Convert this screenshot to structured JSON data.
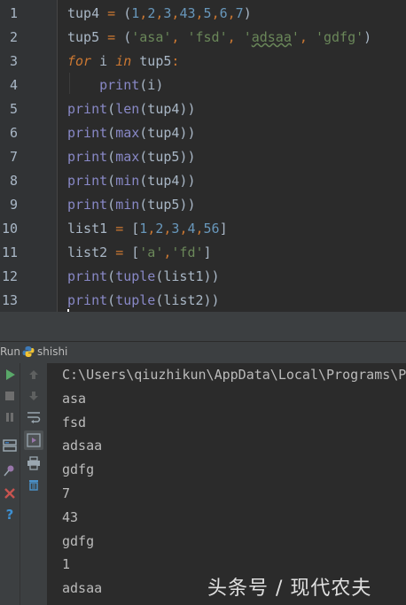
{
  "editor": {
    "line_numbers": [
      "1",
      "2",
      "3",
      "4",
      "5",
      "6",
      "7",
      "8",
      "9",
      "10",
      "11",
      "12",
      "13"
    ],
    "lines": [
      [
        {
          "t": "tup4 ",
          "c": ""
        },
        {
          "t": "=",
          "c": "op"
        },
        {
          "t": " (",
          "c": ""
        },
        {
          "t": "1",
          "c": "num"
        },
        {
          "t": ",",
          "c": "op"
        },
        {
          "t": "2",
          "c": "num"
        },
        {
          "t": ",",
          "c": "op"
        },
        {
          "t": "3",
          "c": "num"
        },
        {
          "t": ",",
          "c": "op"
        },
        {
          "t": "43",
          "c": "num"
        },
        {
          "t": ",",
          "c": "op"
        },
        {
          "t": "5",
          "c": "num"
        },
        {
          "t": ",",
          "c": "op"
        },
        {
          "t": "6",
          "c": "num"
        },
        {
          "t": ",",
          "c": "op"
        },
        {
          "t": "7",
          "c": "num"
        },
        {
          "t": ")",
          "c": ""
        }
      ],
      [
        {
          "t": "tup5 ",
          "c": ""
        },
        {
          "t": "=",
          "c": "op"
        },
        {
          "t": " (",
          "c": ""
        },
        {
          "t": "'asa'",
          "c": "str"
        },
        {
          "t": ", ",
          "c": "op"
        },
        {
          "t": "'fsd'",
          "c": "str"
        },
        {
          "t": ", ",
          "c": "op"
        },
        {
          "t": "'",
          "c": "str"
        },
        {
          "t": "adsaa",
          "c": "str squig"
        },
        {
          "t": "'",
          "c": "str"
        },
        {
          "t": ", ",
          "c": "op"
        },
        {
          "t": "'gdfg'",
          "c": "str"
        },
        {
          "t": ")",
          "c": ""
        }
      ],
      [
        {
          "t": "for",
          "c": "kw"
        },
        {
          "t": " i ",
          "c": ""
        },
        {
          "t": "in",
          "c": "kw"
        },
        {
          "t": " tup5",
          "c": ""
        },
        {
          "t": ":",
          "c": "op"
        }
      ],
      [
        {
          "t": "    ",
          "c": ""
        },
        {
          "t": "print",
          "c": "bi"
        },
        {
          "t": "(i)",
          "c": ""
        }
      ],
      [
        {
          "t": "print",
          "c": "bi"
        },
        {
          "t": "(",
          "c": ""
        },
        {
          "t": "len",
          "c": "bi"
        },
        {
          "t": "(tup4))",
          "c": ""
        }
      ],
      [
        {
          "t": "print",
          "c": "bi"
        },
        {
          "t": "(",
          "c": ""
        },
        {
          "t": "max",
          "c": "bi"
        },
        {
          "t": "(tup4))",
          "c": ""
        }
      ],
      [
        {
          "t": "print",
          "c": "bi"
        },
        {
          "t": "(",
          "c": ""
        },
        {
          "t": "max",
          "c": "bi"
        },
        {
          "t": "(tup5))",
          "c": ""
        }
      ],
      [
        {
          "t": "print",
          "c": "bi"
        },
        {
          "t": "(",
          "c": ""
        },
        {
          "t": "min",
          "c": "bi"
        },
        {
          "t": "(tup4))",
          "c": ""
        }
      ],
      [
        {
          "t": "print",
          "c": "bi"
        },
        {
          "t": "(",
          "c": ""
        },
        {
          "t": "min",
          "c": "bi"
        },
        {
          "t": "(tup5))",
          "c": ""
        }
      ],
      [
        {
          "t": "list1 ",
          "c": ""
        },
        {
          "t": "=",
          "c": "op"
        },
        {
          "t": " [",
          "c": ""
        },
        {
          "t": "1",
          "c": "num"
        },
        {
          "t": ",",
          "c": "op"
        },
        {
          "t": "2",
          "c": "num"
        },
        {
          "t": ",",
          "c": "op"
        },
        {
          "t": "3",
          "c": "num"
        },
        {
          "t": ",",
          "c": "op"
        },
        {
          "t": "4",
          "c": "num"
        },
        {
          "t": ",",
          "c": "op"
        },
        {
          "t": "56",
          "c": "num"
        },
        {
          "t": "]",
          "c": ""
        }
      ],
      [
        {
          "t": "list2 ",
          "c": ""
        },
        {
          "t": "=",
          "c": "op"
        },
        {
          "t": " [",
          "c": ""
        },
        {
          "t": "'a'",
          "c": "str"
        },
        {
          "t": ",",
          "c": "op"
        },
        {
          "t": "'fd'",
          "c": "str"
        },
        {
          "t": "]",
          "c": ""
        }
      ],
      [
        {
          "t": "print",
          "c": "bi"
        },
        {
          "t": "(",
          "c": ""
        },
        {
          "t": "tuple",
          "c": "bi"
        },
        {
          "t": "(list1))",
          "c": ""
        }
      ],
      [
        {
          "t": "print",
          "c": "bi"
        },
        {
          "t": "(",
          "c": ""
        },
        {
          "t": "tuple",
          "c": "bi"
        },
        {
          "t": "(list2))",
          "c": ""
        }
      ]
    ]
  },
  "run_panel": {
    "tab_label": "Run",
    "config_name": "shishi",
    "output": [
      "C:\\Users\\qiuzhikun\\AppData\\Local\\Programs\\Python",
      "asa",
      "fsd",
      "adsaa",
      "gdfg",
      "7",
      "43",
      "gdfg",
      "1",
      "adsaa"
    ]
  },
  "watermark": "头条号 / 现代农夫",
  "colors": {
    "background": "#2b2b2b",
    "gutter": "#313335",
    "keyword": "#cc7832",
    "number": "#6897bb",
    "string": "#6a8759",
    "builtin": "#8888c6",
    "text": "#a9b7c6"
  }
}
